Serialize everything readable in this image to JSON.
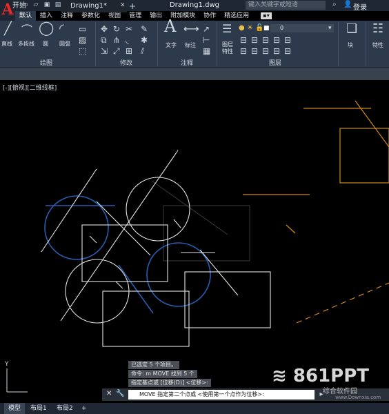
{
  "titlebar": {
    "document_title": "Drawing1.dwg",
    "search_placeholder": "键入关键字或短语",
    "login_label": "登录"
  },
  "ribbon_tabs": [
    "默认",
    "插入",
    "注释",
    "参数化",
    "视图",
    "管理",
    "输出",
    "附加模块",
    "协作",
    "精选应用"
  ],
  "ribbon": {
    "draw": {
      "line": "直线",
      "polyline": "多段线",
      "circle": "圆",
      "arc": "圆弧",
      "panel": "绘图"
    },
    "modify": {
      "panel": "修改"
    },
    "annotation": {
      "text": "文字",
      "dimension": "标注",
      "panel": "注释"
    },
    "layers": {
      "properties_l1": "图层",
      "properties_l2": "特性",
      "current_layer": "0",
      "panel": "图层"
    },
    "block": {
      "label": "块"
    },
    "properties": {
      "label": "特性"
    }
  },
  "file_tabs": {
    "start": "开始",
    "drawing": "Drawing1*"
  },
  "viewport_label": "[-][俯视][二维线框]",
  "command_history": [
    "已选定 5 个项目。",
    "命令: m MOVE 找到 5 个",
    "指定基点或 [位移(D)] <位移>:"
  ],
  "command_prompt": "MOVE 指定第二个点或 <使用第一个点作为位移>:",
  "layout_tabs": [
    "模型",
    "布局1",
    "布局2"
  ],
  "watermark": {
    "brand": "861PPT",
    "sub": "综合软件园",
    "url": "www.Downxia.com"
  },
  "colors": {
    "ribbon_bg": "#2d3a4b",
    "selection_white": "#e6e6e6",
    "selection_blue": "#2a5db0",
    "orange": "#d08a1c",
    "ghost": "#3a3a3a"
  }
}
